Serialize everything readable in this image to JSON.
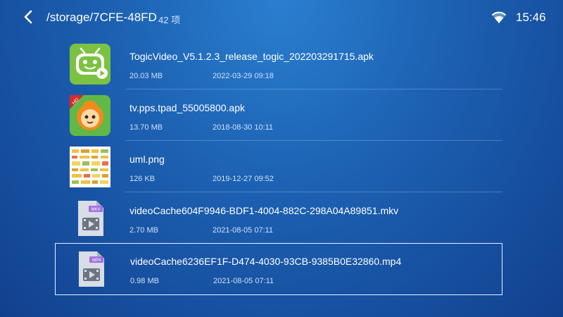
{
  "header": {
    "path": "/storage/7CFE-48FD",
    "count": "42 项",
    "time": "15:46"
  },
  "icons": {
    "back": "chevron-left-icon",
    "wifi": "wifi-icon"
  },
  "files": [
    {
      "name": "TogicVideo_V5.1.2.3_release_togic_202203291715.apk",
      "size": "20.03 MB",
      "date": "2022-03-29 09:18",
      "icon": "togic-app-icon"
    },
    {
      "name": "tv.pps.tpad_55005800.apk",
      "size": "13.70 MB",
      "date": "2018-08-30 10:11",
      "icon": "pps-app-icon",
      "badge": "HD"
    },
    {
      "name": "uml.png",
      "size": "126 KB",
      "date": "2019-12-27 09:52",
      "icon": "image-thumbnail"
    },
    {
      "name": "videoCache604F9946-BDF1-4004-882C-298A04A89851.mkv",
      "size": "2.70 MB",
      "date": "2021-08-05 07:11",
      "icon": "video-file-icon",
      "badge": "MKV"
    },
    {
      "name": "videoCache6236EF1F-D474-4030-93CB-9385B0E32860.mp4",
      "size": "0.98 MB",
      "date": "2021-08-05 07:11",
      "icon": "video-file-icon",
      "badge": "MP4",
      "selected": true
    }
  ],
  "colors": {
    "bg_top": "#2a7fd0",
    "bg_bottom": "#12408f",
    "togic_green": "#7cc242",
    "pps_green": "#62b846",
    "video_purple": "#a070e0"
  }
}
